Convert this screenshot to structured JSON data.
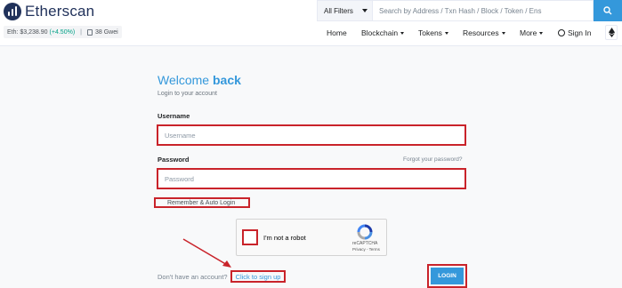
{
  "brand": {
    "name": "Etherscan"
  },
  "stats": {
    "eth_label": "Eth: $3,238.90",
    "eth_change": "(+4.50%)",
    "separator": "|",
    "gas": "38 Gwei"
  },
  "search": {
    "filter_label": "All Filters",
    "placeholder": "Search by Address / Txn Hash / Block / Token / Ens"
  },
  "nav": {
    "home": "Home",
    "blockchain": "Blockchain",
    "tokens": "Tokens",
    "resources": "Resources",
    "more": "More",
    "sign_in": "Sign In"
  },
  "login": {
    "title_prefix": "Welcome ",
    "title_bold": "back",
    "subtitle": "Login to your account",
    "username_label": "Username",
    "username_placeholder": "Username",
    "password_label": "Password",
    "password_placeholder": "Password",
    "forgot_link": "Forgot your password?",
    "remember_label": "Remember & Auto Login",
    "captcha_text": "I'm not a robot",
    "captcha_brand": "reCAPTCHA",
    "captcha_terms": "Privacy - Terms",
    "signup_question": "Don't have an account?",
    "signup_link": "Click to sign up",
    "login_button": "LOGIN"
  },
  "colors": {
    "accent": "#3498db",
    "highlight": "#c9232a",
    "positive": "#00a186",
    "brand_dark": "#21325b"
  }
}
